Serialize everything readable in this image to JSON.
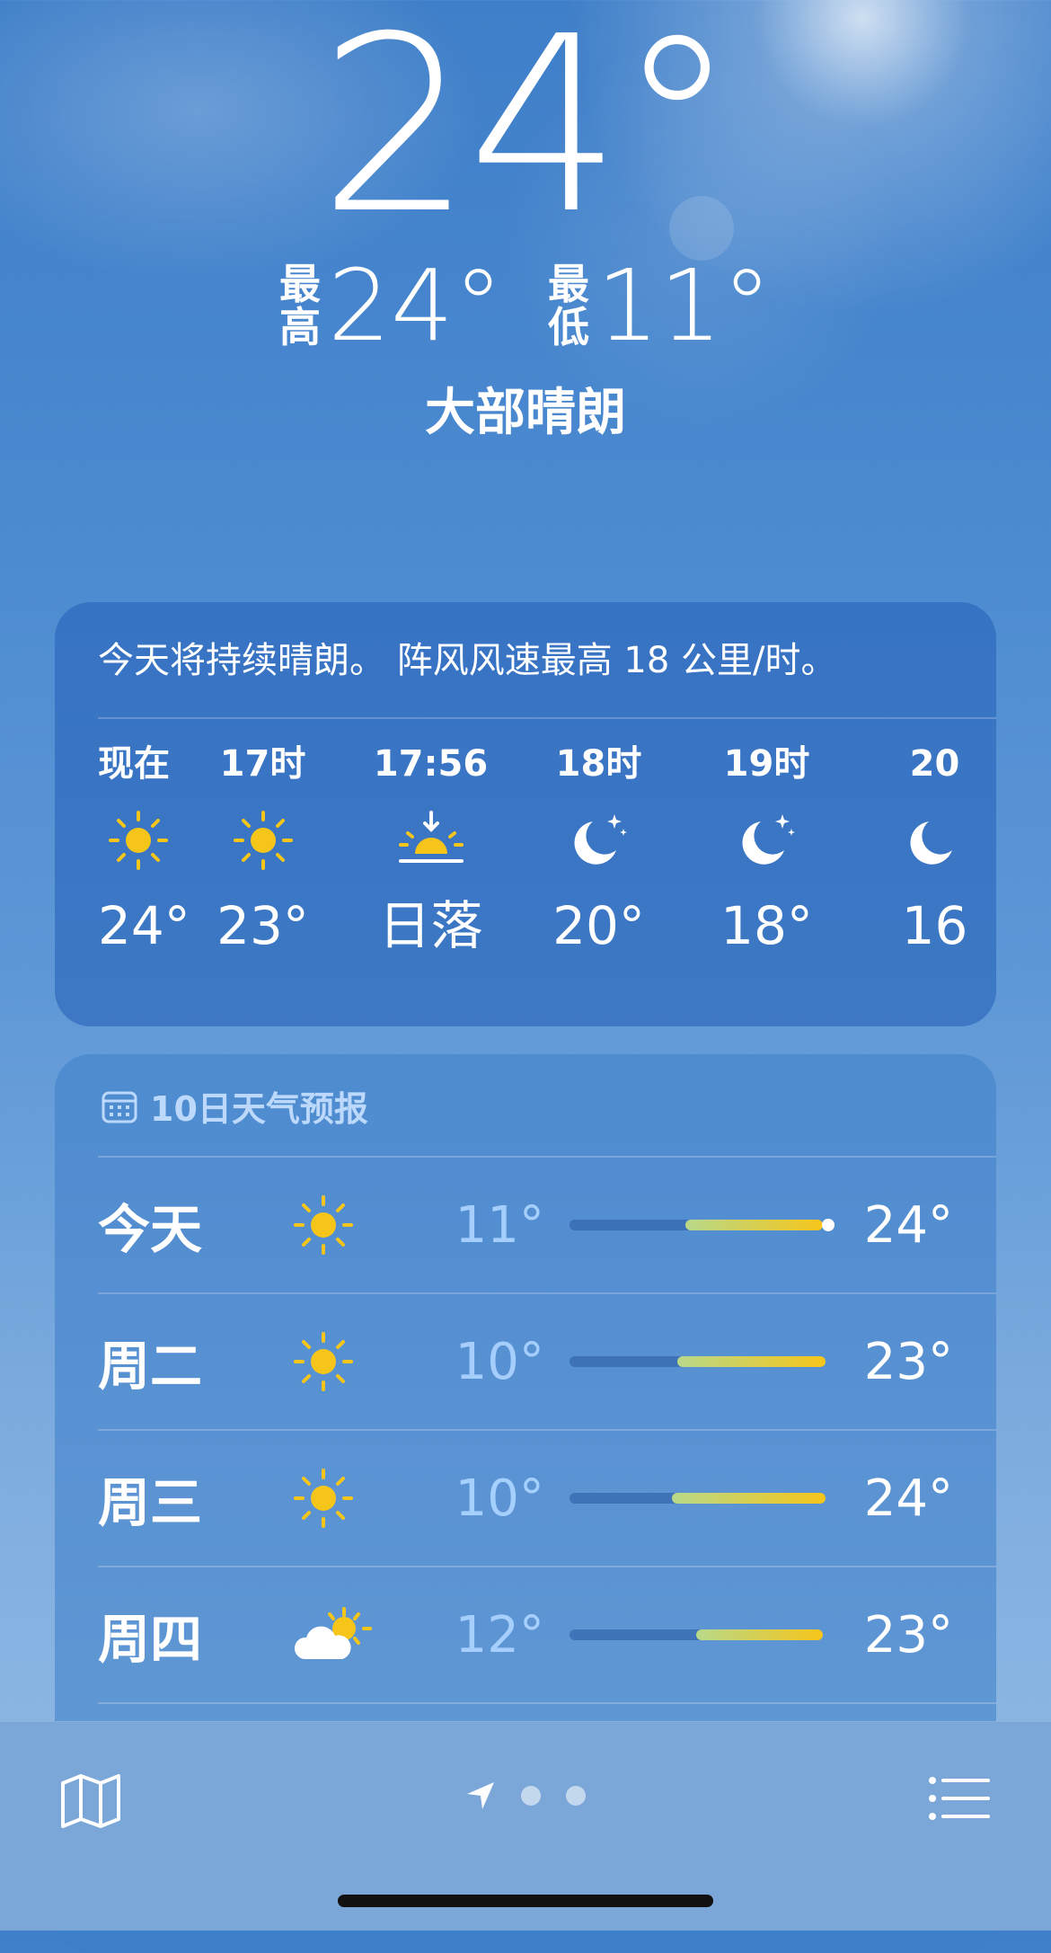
{
  "current": {
    "temperature": "24°",
    "high_label_1": "最",
    "high_label_2": "高",
    "high": "24°",
    "low_label_1": "最",
    "low_label_2": "低",
    "low": "11°",
    "condition": "大部晴朗"
  },
  "hourly": {
    "summary": "今天将持续晴朗。 阵风风速最高 18 公里/时。",
    "items": [
      {
        "time": "现在",
        "icon": "sun-icon",
        "temp": "24°"
      },
      {
        "time": "17时",
        "icon": "sun-icon",
        "temp": "23°"
      },
      {
        "time": "17:56",
        "icon": "sunset-icon",
        "temp": "日落"
      },
      {
        "time": "18时",
        "icon": "moon-stars-icon",
        "temp": "20°"
      },
      {
        "time": "19时",
        "icon": "moon-stars-icon",
        "temp": "18°"
      },
      {
        "time": "20",
        "icon": "moon-stars-icon",
        "temp": "16"
      }
    ]
  },
  "daily": {
    "header": "10日天气预报",
    "days": [
      {
        "name": "今天",
        "icon": "sun-icon",
        "low": "11°",
        "high": "24°",
        "bar_start": 0.43,
        "bar_end": 0.94,
        "current_dot": 0.96
      },
      {
        "name": "周二",
        "icon": "sun-icon",
        "low": "10°",
        "high": "23°",
        "bar_start": 0.4,
        "bar_end": 0.95
      },
      {
        "name": "周三",
        "icon": "sun-icon",
        "low": "10°",
        "high": "24°",
        "bar_start": 0.38,
        "bar_end": 0.95
      },
      {
        "name": "周四",
        "icon": "partly-cloudy-icon",
        "low": "12°",
        "high": "23°",
        "bar_start": 0.47,
        "bar_end": 0.94
      }
    ]
  },
  "colors": {
    "sun": "#f6c51a",
    "bar_cool": "#b8d98a",
    "bar_warm": "#f6c51a"
  }
}
